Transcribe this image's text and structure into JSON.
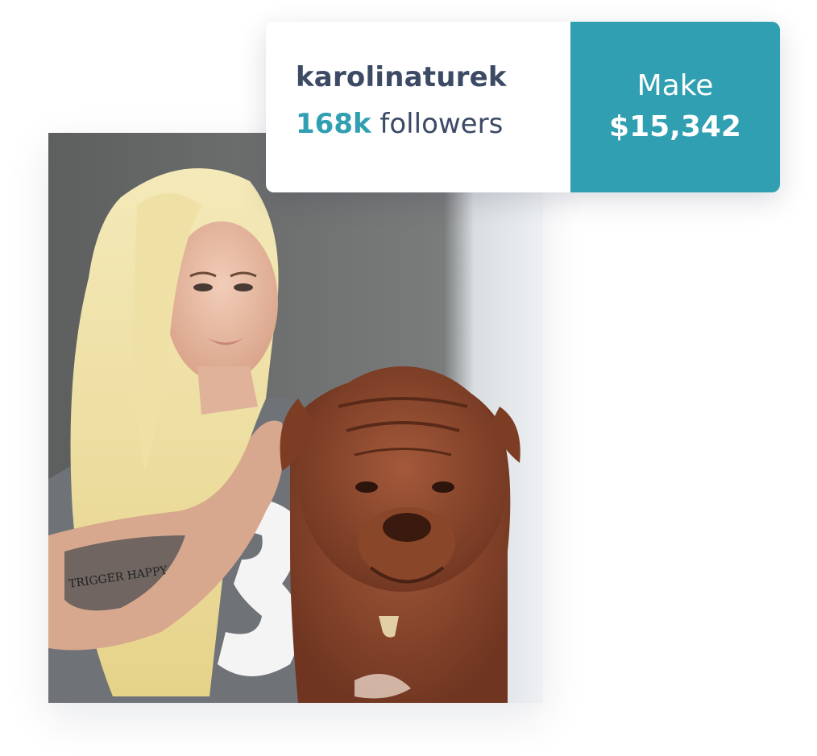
{
  "profile": {
    "username": "karolinaturek",
    "followers_count": "168k",
    "followers_label": "followers"
  },
  "earnings": {
    "label": "Make",
    "amount": "$15,342"
  },
  "photo": {
    "tattoo_text": "TRIGGER HAPPY",
    "shirt_print": "13"
  },
  "colors": {
    "accent": "#309fb1",
    "text_dark": "#3c4a66"
  }
}
